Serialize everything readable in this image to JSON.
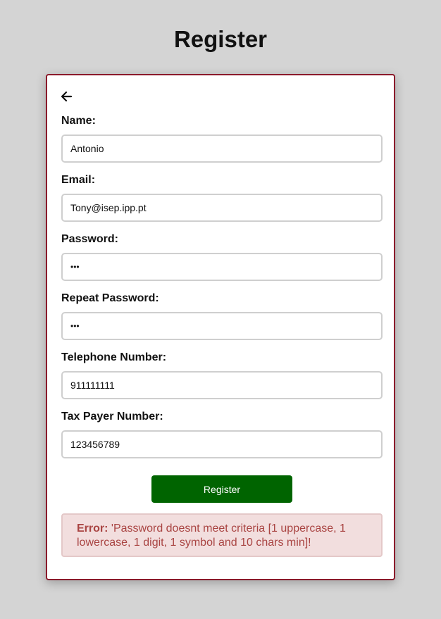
{
  "page": {
    "title": "Register"
  },
  "form": {
    "fields": [
      {
        "label": "Name:",
        "value": "Antonio",
        "type": "text"
      },
      {
        "label": "Email:",
        "value": "Tony@isep.ipp.pt",
        "type": "text"
      },
      {
        "label": "Password:",
        "value": "•••",
        "type": "password"
      },
      {
        "label": "Repeat Password:",
        "value": "•••",
        "type": "password"
      },
      {
        "label": "Telephone Number:",
        "value": "911111111",
        "type": "text"
      },
      {
        "label": "Tax Payer Number:",
        "value": "123456789",
        "type": "text"
      }
    ],
    "submit_label": "Register"
  },
  "error": {
    "prefix": "Error:",
    "message": "'Password doesnt meet criteria [1 uppercase, 1 lowercase, 1 digit, 1 symbol and 10 chars min]!"
  },
  "colors": {
    "background": "#d4d4d4",
    "card_border": "#8b1a2b",
    "button": "#006400",
    "error_bg": "#f2dede",
    "error_text": "#a94442"
  },
  "icons": {
    "back": "arrow-left-icon"
  }
}
